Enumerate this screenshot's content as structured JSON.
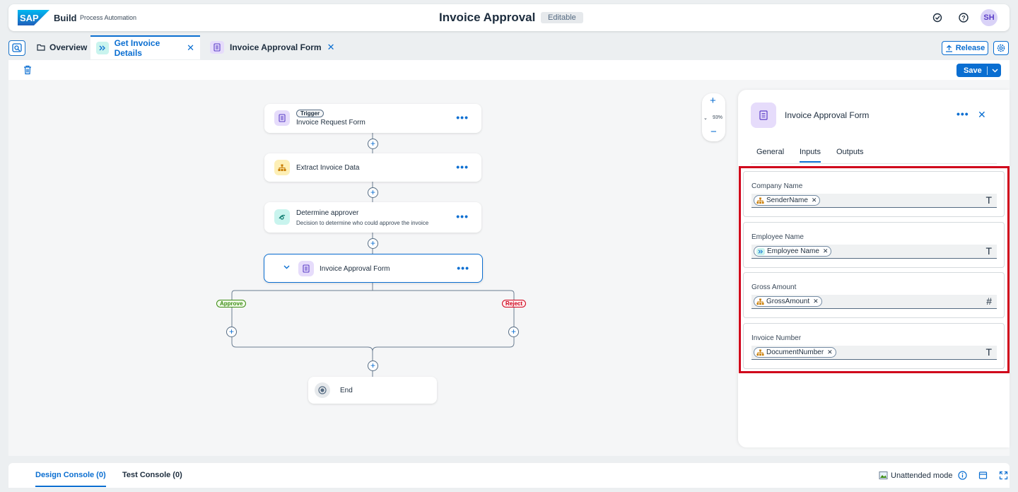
{
  "shell": {
    "logo_text": "SAP",
    "product": "Build",
    "subtitle": "Process Automation",
    "title": "Invoice Approval",
    "status_badge": "Editable",
    "avatar_initials": "SH"
  },
  "tabs": {
    "overview": "Overview",
    "get_invoice_details": "Get Invoice Details",
    "invoice_approval_form": "Invoice Approval Form",
    "release": "Release"
  },
  "toolbar": {
    "save": "Save"
  },
  "canvas": {
    "zoom_level": "93%",
    "nodes": {
      "trigger_chip": "Trigger",
      "invoice_request_form": "Invoice Request Form",
      "extract_invoice_data": "Extract Invoice Data",
      "determine_approver": "Determine approver",
      "determine_approver_desc": "Decision to determine who could approve the invoice",
      "invoice_approval_form": "Invoice Approval Form",
      "end": "End"
    },
    "branches": {
      "approve": "Approve",
      "reject": "Reject"
    }
  },
  "panel": {
    "title": "Invoice Approval Form",
    "tabs": [
      "General",
      "Inputs",
      "Outputs"
    ],
    "fields": [
      {
        "label": "Company Name",
        "token": "SenderName",
        "token_icon": "hierarchy-icon",
        "type_glyph": "T"
      },
      {
        "label": "Employee Name",
        "token": "Employee Name",
        "token_icon": "chevrons-icon",
        "type_glyph": "T"
      },
      {
        "label": "Gross Amount",
        "token": "GrossAmount",
        "token_icon": "hierarchy-icon",
        "type_glyph": "#"
      },
      {
        "label": "Invoice Number",
        "token": "DocumentNumber",
        "token_icon": "hierarchy-icon",
        "type_glyph": "T"
      }
    ]
  },
  "console": {
    "design": "Design Console (0)",
    "test": "Test Console (0)",
    "mode": "Unattended mode"
  },
  "colors": {
    "accent": "#0a6ed1",
    "highlight": "#d0021b",
    "approve": "#3c8c14",
    "reject": "#d0021b"
  }
}
